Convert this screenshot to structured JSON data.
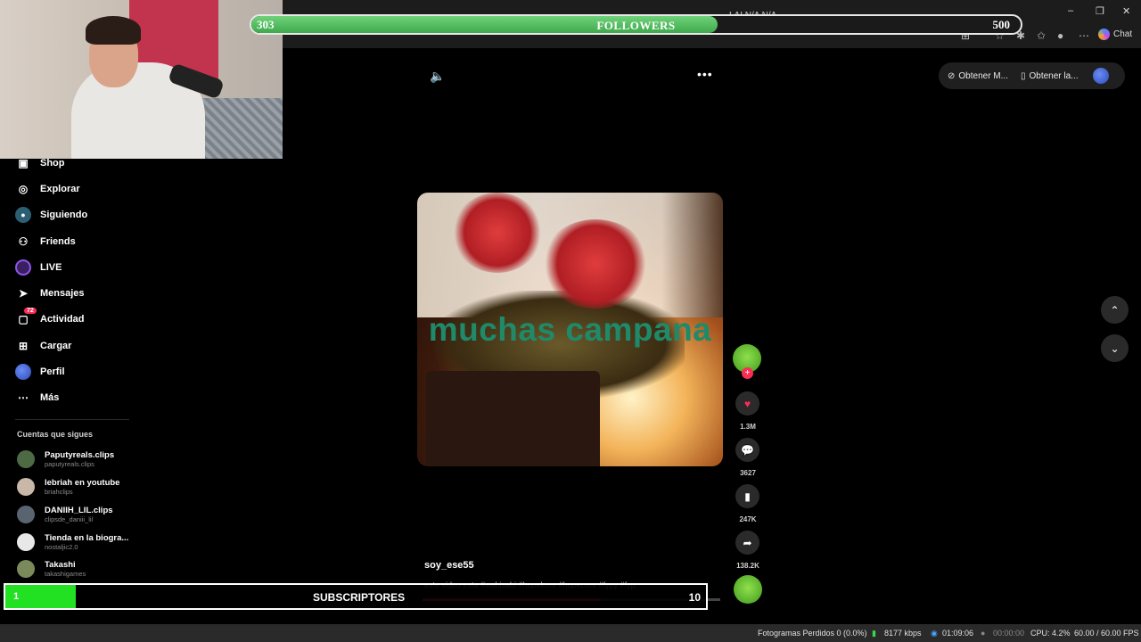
{
  "browser": {
    "tab_text": "LAI  N/A  N/A",
    "window_controls": [
      "–",
      "❐",
      "✕"
    ],
    "chat_label": "Chat"
  },
  "followers_goal": {
    "current": "303",
    "label": "FOLLOWERS",
    "goal": "500",
    "progress_fraction": 0.606
  },
  "top_buttons": {
    "volume_icon": "speaker-icon",
    "more_icon": "more-dots-icon",
    "obtener_1": "Obtener M...",
    "obtener_2": "Obtener la..."
  },
  "sidebar": {
    "items": [
      {
        "label": "Shop",
        "icon": "shop-icon"
      },
      {
        "label": "Explorar",
        "icon": "compass-icon"
      },
      {
        "label": "Siguiendo",
        "icon": "following-icon"
      },
      {
        "label": "Friends",
        "icon": "friends-icon"
      },
      {
        "label": "LIVE",
        "icon": "live-icon"
      },
      {
        "label": "Mensajes",
        "icon": "messages-icon"
      },
      {
        "label": "Actividad",
        "icon": "activity-icon",
        "badge": "72"
      },
      {
        "label": "Cargar",
        "icon": "upload-icon"
      },
      {
        "label": "Perfil",
        "icon": "profile-icon"
      },
      {
        "label": "Más",
        "icon": "more-icon"
      }
    ],
    "following_title": "Cuentas que sigues",
    "accounts": [
      {
        "name": "Paputyreals.clips",
        "handle": "paputyreals.clips"
      },
      {
        "name": "lebriah en youtube",
        "handle": "briahclips"
      },
      {
        "name": "DANIIH_LIL.clips",
        "handle": "clipsde_daniii_lil"
      },
      {
        "name": "Tienda en la biogra...",
        "handle": "nostaljic2.0"
      },
      {
        "name": "Takashi",
        "handle": "takashigames"
      }
    ]
  },
  "video": {
    "caption": "muchas campana",
    "author": "soy_ese55",
    "description": "este video esta #wabisabi #hopekore #hopecore #fypy #fyp",
    "progress_fraction": 0.6
  },
  "actions": {
    "likes": "1.3M",
    "comments": "3627",
    "saves": "247K",
    "shares": "138.2K"
  },
  "subscribers_goal": {
    "current": "1",
    "label": "SUBSCRIPTORES",
    "goal": "10",
    "progress_fraction": 0.1
  },
  "status_bar": {
    "frames": "Fotogramas Perdidos 0 (0.0%)",
    "bitrate": "8177 kbps",
    "time_live": "01:09:06",
    "time_rec": "00:00:00",
    "cpu": "CPU: 4.2%",
    "fps": "60.00 / 60.00 FPS"
  }
}
